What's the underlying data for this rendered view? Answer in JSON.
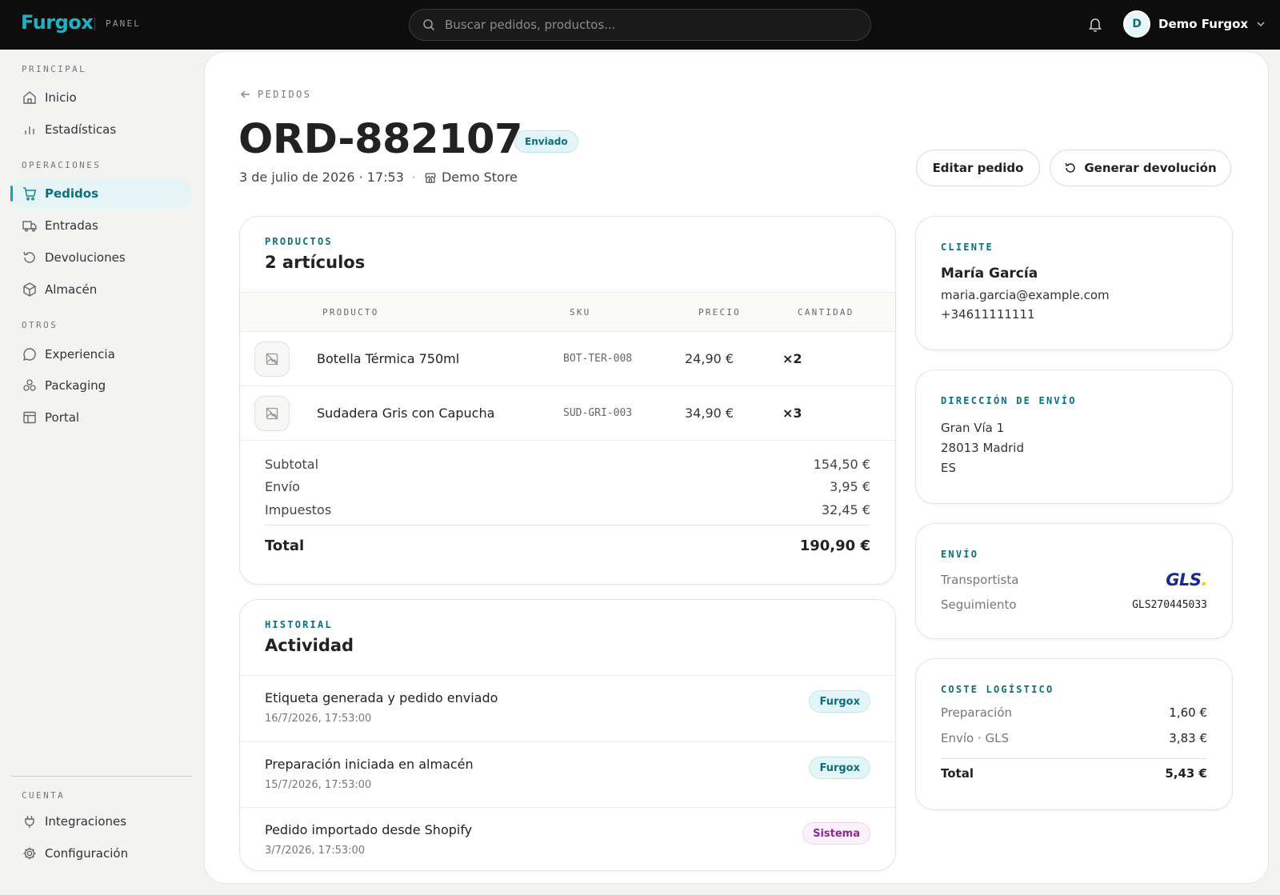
{
  "topbar": {
    "logo": "Furgox",
    "panel_label": "PANEL",
    "search_placeholder": "Buscar pedidos, productos...",
    "user_initial": "D",
    "user_name": "Demo Furgox"
  },
  "sidebar": {
    "sections": {
      "principal": "PRINCIPAL",
      "operaciones": "OPERACIONES",
      "otros": "OTROS",
      "cuenta": "CUENTA"
    },
    "items": {
      "inicio": "Inicio",
      "estadisticas": "Estadísticas",
      "pedidos": "Pedidos",
      "entradas": "Entradas",
      "devoluciones": "Devoluciones",
      "almacen": "Almacén",
      "experiencia": "Experiencia",
      "packaging": "Packaging",
      "portal": "Portal",
      "integraciones": "Integraciones",
      "configuracion": "Configuración"
    },
    "active": "Pedidos"
  },
  "header": {
    "back_label": "PEDIDOS",
    "order_id": "ORD-882107",
    "status": "Enviado",
    "date": "3 de julio de 2026 · 17:53",
    "store": "Demo Store",
    "edit_button": "Editar pedido",
    "return_button": "Generar devolución"
  },
  "products": {
    "eyebrow": "PRODUCTOS",
    "title": "2 artículos",
    "columns": {
      "product": "PRODUCTO",
      "sku": "SKU",
      "price": "PRECIO",
      "quantity": "CANTIDAD"
    },
    "rows": [
      {
        "name": "Botella Térmica 750ml",
        "sku": "BOT-TER-008",
        "price": "24,90 €",
        "qty": "×2"
      },
      {
        "name": "Sudadera Gris con Capucha",
        "sku": "SUD-GRI-003",
        "price": "34,90 €",
        "qty": "×3"
      }
    ],
    "summary": {
      "subtotal_label": "Subtotal",
      "subtotal": "154,50 €",
      "shipping_label": "Envío",
      "shipping": "3,95 €",
      "taxes_label": "Impuestos",
      "taxes": "32,45 €",
      "total_label": "Total",
      "total": "190,90 €"
    }
  },
  "history": {
    "eyebrow": "HISTORIAL",
    "title": "Actividad",
    "events": [
      {
        "text": "Etiqueta generada y pedido enviado",
        "date": "16/7/2026, 17:53:00",
        "source": "Furgox"
      },
      {
        "text": "Preparación iniciada en almacén",
        "date": "15/7/2026, 17:53:00",
        "source": "Furgox"
      },
      {
        "text": "Pedido importado desde Shopify",
        "date": "3/7/2026, 17:53:00",
        "source": "Sistema"
      }
    ]
  },
  "customer": {
    "eyebrow": "CLIENTE",
    "name": "María García",
    "email": "maria.garcia@example.com",
    "phone": "+34611111111"
  },
  "address": {
    "eyebrow": "DIRECCIÓN DE ENVÍO",
    "line1": "Gran Vía 1",
    "line2": "28013 Madrid",
    "country": "ES"
  },
  "shipping": {
    "eyebrow": "ENVÍO",
    "carrier_label": "Transportista",
    "carrier_logo": "GLS",
    "tracking_label": "Seguimiento",
    "tracking": "GLS270445033"
  },
  "logistics": {
    "eyebrow": "COSTE LOGÍSTICO",
    "prep_label": "Preparación",
    "prep": "1,60 €",
    "ship_label": "Envío · GLS",
    "ship": "3,83 €",
    "total_label": "Total",
    "total": "5,43 €"
  },
  "colors": {
    "accent": "#15a3b4",
    "accent_dark": "#0b6f7d",
    "topbar": "#0d0d0d",
    "gls_blue": "#1a2a8c",
    "gls_yellow": "#f5c400"
  }
}
